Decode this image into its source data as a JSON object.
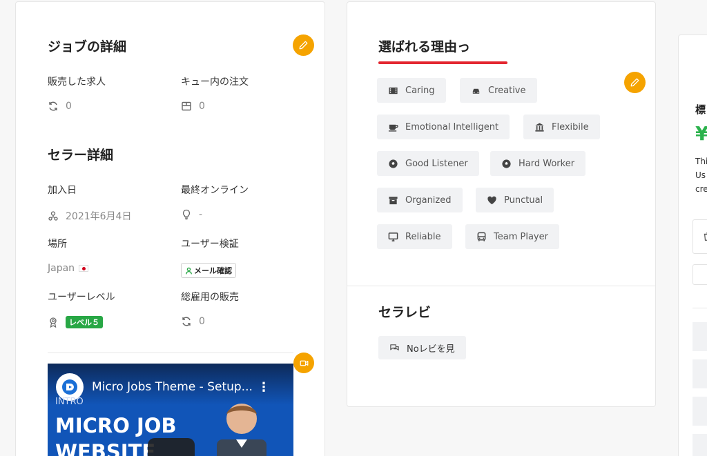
{
  "job_details": {
    "title": "ジョブの詳細",
    "sold_label": "販売した求人",
    "sold_value": "0",
    "queue_label": "キュー内の注文",
    "queue_value": "0"
  },
  "seller_details": {
    "title": "セラー詳細",
    "joined_label": "加入日",
    "joined_value": "2021年6月4日",
    "last_online_label": "最終オンライン",
    "last_online_value": "-",
    "location_label": "場所",
    "location_value": "Japan",
    "verification_label": "ユーザー検証",
    "verification_badge": "メール確認",
    "level_label": "ユーザーレベル",
    "level_badge": "レベル５",
    "total_sales_label": "総雇用の販売",
    "total_sales_value": "0"
  },
  "video": {
    "title": "Micro Jobs Theme - Setup...",
    "intro": "INTRO",
    "headline_1": "MICRO JOB",
    "headline_2": "WEBSITE"
  },
  "reasons": {
    "title": "選ばれる理由っ",
    "tags": [
      {
        "label": "Caring",
        "icon": "film-icon"
      },
      {
        "label": "Creative",
        "icon": "car-icon"
      },
      {
        "label": "Emotional Intelligent",
        "icon": "coffee-icon"
      },
      {
        "label": "Flexibile",
        "icon": "bank-icon"
      },
      {
        "label": "Good Listener",
        "icon": "soccer-ball-icon"
      },
      {
        "label": "Hard Worker",
        "icon": "soccer-ball-icon"
      },
      {
        "label": "Organized",
        "icon": "archive-icon"
      },
      {
        "label": "Punctual",
        "icon": "heart-icon"
      },
      {
        "label": "Reliable",
        "icon": "desktop-icon"
      },
      {
        "label": "Team Player",
        "icon": "bus-icon"
      }
    ]
  },
  "reviews": {
    "title": "セラレビ",
    "button_label": "Noレビを見"
  },
  "right_card": {
    "heading_fragment": "標",
    "price_fragment": "¥",
    "line_1": "Thi",
    "line_2": "Us",
    "line_3": "cre"
  },
  "colors": {
    "accent_orange": "#f5a300",
    "underline_red": "#e3262f",
    "badge_green": "#28a745",
    "price_green": "#2bb24c"
  }
}
